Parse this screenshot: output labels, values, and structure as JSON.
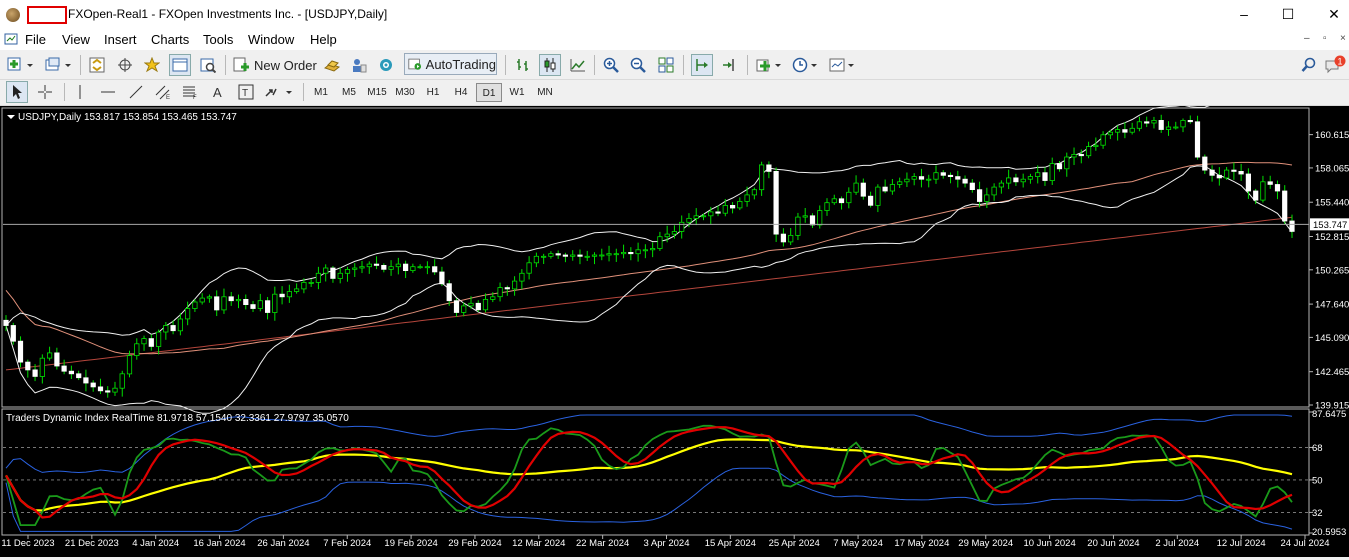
{
  "window": {
    "title": "FXOpen-Real1 - FXOpen Investments Inc. - [USDJPY,Daily]",
    "controls": [
      "–",
      "☐",
      "✕"
    ]
  },
  "menu": {
    "items": [
      "File",
      "View",
      "Insert",
      "Charts",
      "Tools",
      "Window",
      "Help"
    ],
    "mdi": [
      "–",
      "▫",
      "×"
    ]
  },
  "toolbar": {
    "new_order": "New Order",
    "autotrading": "AutoTrading",
    "periods": [
      "M1",
      "M5",
      "M15",
      "M30",
      "H1",
      "H4",
      "D1",
      "W1",
      "MN"
    ],
    "active_period": "D1",
    "notification_count": "1"
  },
  "chart": {
    "header": "USDJPY,Daily  153.817 153.854 153.465 153.747",
    "price_labels": [
      "160.615",
      "158.065",
      "155.440",
      "152.815",
      "150.265",
      "147.640",
      "145.090",
      "142.465",
      "139.915"
    ],
    "current_price": "153.747",
    "ind_header": "Traders Dynamic Index RealTime 81.9718 57.1540 32.3361 27.9797 35.0570",
    "ind_labels": [
      "87.6475",
      "68",
      "50",
      "32",
      "20.5953"
    ],
    "date_labels": [
      "11 Dec 2023",
      "21 Dec 2023",
      "4 Jan 2024",
      "16 Jan 2024",
      "26 Jan 2024",
      "7 Feb 2024",
      "19 Feb 2024",
      "29 Feb 2024",
      "12 Mar 2024",
      "22 Mar 2024",
      "3 Apr 2024",
      "15 Apr 2024",
      "25 Apr 2024",
      "7 May 2024",
      "17 May 2024",
      "29 May 2024",
      "10 Jun 2024",
      "20 Jun 2024",
      "2 Jul 2024",
      "12 Jul 2024",
      "24 Jul 2024"
    ]
  },
  "chart_data": {
    "type": "candlestick",
    "symbol": "USDJPY",
    "timeframe": "Daily",
    "ohlc_last": {
      "open": 153.817,
      "high": 153.854,
      "low": 153.465,
      "close": 153.747
    },
    "y_range": [
      139.915,
      162.5
    ],
    "closes": [
      146.0,
      144.8,
      143.2,
      142.6,
      142.1,
      143.5,
      143.9,
      142.9,
      142.5,
      142.3,
      142.0,
      141.6,
      141.3,
      141.0,
      140.9,
      141.2,
      142.3,
      143.7,
      144.6,
      145.0,
      144.4,
      145.5,
      146.0,
      145.6,
      146.5,
      147.3,
      147.8,
      148.1,
      148.2,
      147.2,
      148.2,
      147.9,
      148.0,
      147.6,
      147.3,
      147.9,
      147.0,
      148.4,
      148.2,
      148.6,
      148.8,
      149.3,
      149.3,
      150.0,
      150.4,
      149.6,
      150.0,
      150.3,
      150.4,
      150.5,
      150.7,
      150.6,
      150.3,
      150.5,
      150.7,
      150.2,
      150.5,
      150.5,
      150.5,
      150.1,
      149.2,
      147.9,
      147.0,
      147.5,
      147.7,
      147.2,
      148.0,
      148.2,
      148.9,
      148.8,
      149.4,
      150.0,
      150.8,
      151.3,
      151.3,
      151.5,
      151.4,
      151.3,
      151.4,
      151.3,
      151.3,
      151.4,
      151.4,
      151.5,
      151.5,
      151.6,
      151.5,
      151.8,
      151.8,
      151.9,
      152.8,
      153.0,
      153.2,
      153.9,
      154.2,
      154.4,
      154.4,
      154.7,
      154.6,
      155.2,
      155.0,
      155.5,
      156.0,
      156.4,
      158.3,
      157.8,
      153.0,
      152.4,
      152.9,
      154.3,
      154.4,
      153.7,
      154.8,
      155.4,
      155.7,
      155.4,
      156.2,
      156.9,
      155.9,
      155.2,
      156.6,
      156.3,
      156.8,
      157.0,
      157.2,
      157.4,
      157.2,
      157.2,
      157.7,
      157.5,
      157.4,
      157.2,
      156.9,
      156.4,
      155.5,
      156.0,
      156.6,
      156.9,
      157.3,
      157.0,
      157.2,
      157.4,
      157.7,
      157.1,
      158.4,
      158.0,
      158.9,
      159.1,
      159.0,
      159.7,
      159.8,
      160.6,
      160.8,
      161.0,
      160.8,
      161.1,
      161.6,
      161.5,
      161.7,
      161.0,
      161.2,
      161.2,
      161.7,
      161.6,
      158.9,
      157.9,
      157.5,
      157.3,
      157.9,
      157.8,
      157.6,
      156.3,
      155.6,
      157.0,
      156.8,
      156.3,
      154.0,
      153.2
    ],
    "series": [
      {
        "name": "Bollinger Bands"
      },
      {
        "name": "Moving Average"
      },
      {
        "name": "Moving Average"
      }
    ],
    "indicator": {
      "name": "Traders Dynamic Index RealTime",
      "values": [
        81.9718,
        57.154,
        32.3361,
        27.9797,
        35.057
      ],
      "levels": [
        68,
        50,
        32
      ],
      "y_range": [
        20.5953,
        87.6475
      ]
    }
  }
}
